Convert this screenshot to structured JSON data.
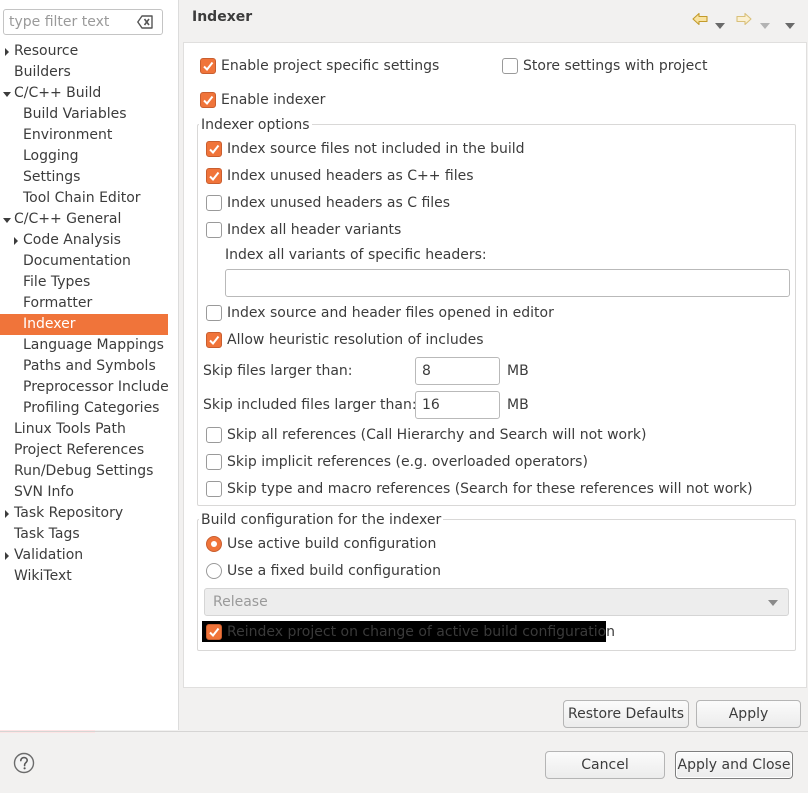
{
  "filter": {
    "placeholder": "type filter text"
  },
  "tree": [
    {
      "label": "Resource",
      "indent": 0,
      "arrow": "right"
    },
    {
      "label": "Builders",
      "indent": 0,
      "arrow": null
    },
    {
      "label": "C/C++ Build",
      "indent": 0,
      "arrow": "down"
    },
    {
      "label": "Build Variables",
      "indent": 1,
      "arrow": null
    },
    {
      "label": "Environment",
      "indent": 1,
      "arrow": null
    },
    {
      "label": "Logging",
      "indent": 1,
      "arrow": null
    },
    {
      "label": "Settings",
      "indent": 1,
      "arrow": null
    },
    {
      "label": "Tool Chain Editor",
      "indent": 1,
      "arrow": null
    },
    {
      "label": "C/C++ General",
      "indent": 0,
      "arrow": "down"
    },
    {
      "label": "Code Analysis",
      "indent": 1,
      "arrow": "right"
    },
    {
      "label": "Documentation",
      "indent": 1,
      "arrow": null
    },
    {
      "label": "File Types",
      "indent": 1,
      "arrow": null
    },
    {
      "label": "Formatter",
      "indent": 1,
      "arrow": null
    },
    {
      "label": "Indexer",
      "indent": 1,
      "arrow": null,
      "selected": true
    },
    {
      "label": "Language Mappings",
      "indent": 1,
      "arrow": null
    },
    {
      "label": "Paths and Symbols",
      "indent": 1,
      "arrow": null
    },
    {
      "label": "Preprocessor Include",
      "indent": 1,
      "arrow": null
    },
    {
      "label": "Profiling Categories",
      "indent": 1,
      "arrow": null
    },
    {
      "label": "Linux Tools Path",
      "indent": 0,
      "arrow": null
    },
    {
      "label": "Project References",
      "indent": 0,
      "arrow": null
    },
    {
      "label": "Run/Debug Settings",
      "indent": 0,
      "arrow": null
    },
    {
      "label": "SVN Info",
      "indent": 0,
      "arrow": null
    },
    {
      "label": "Task Repository",
      "indent": 0,
      "arrow": "right"
    },
    {
      "label": "Task Tags",
      "indent": 0,
      "arrow": null
    },
    {
      "label": "Validation",
      "indent": 0,
      "arrow": "right"
    },
    {
      "label": "WikiText",
      "indent": 0,
      "arrow": null
    }
  ],
  "header": {
    "title": "Indexer"
  },
  "project": {
    "enable_specific": {
      "label": "Enable project specific settings",
      "checked": true
    },
    "store_with_project": {
      "label": "Store settings with project",
      "checked": false
    },
    "enable_indexer": {
      "label": "Enable indexer",
      "checked": true
    }
  },
  "indexer_options": {
    "legend": "Indexer options",
    "index_not_in_build": {
      "label": "Index source files not included in the build",
      "checked": true
    },
    "unused_cpp": {
      "label": "Index unused headers as C++ files",
      "checked": true
    },
    "unused_c": {
      "label": "Index unused headers as C files",
      "checked": false
    },
    "all_variants": {
      "label": "Index all header variants",
      "checked": false
    },
    "specific_headers_label": "Index all variants of specific headers:",
    "specific_headers_value": "",
    "opened_in_editor": {
      "label": "Index source and header files opened in editor",
      "checked": false
    },
    "heuristic": {
      "label": "Allow heuristic resolution of includes",
      "checked": true
    },
    "skip_larger_label": "Skip files larger than:",
    "skip_larger_value": "8",
    "skip_larger_unit": "MB",
    "skip_included_label": "Skip included files larger than:",
    "skip_included_value": "16",
    "skip_included_unit": "MB",
    "skip_all_refs": {
      "label": "Skip all references (Call Hierarchy and Search will not work)",
      "checked": false
    },
    "skip_implicit": {
      "label": "Skip implicit references (e.g. overloaded operators)",
      "checked": false
    },
    "skip_type_macro": {
      "label": "Skip type and macro references (Search for these references will not work)",
      "checked": false
    }
  },
  "build_config": {
    "legend": "Build configuration for the indexer",
    "use_active": {
      "label": "Use active build configuration",
      "selected": true
    },
    "use_fixed": {
      "label": "Use a fixed build configuration",
      "selected": false
    },
    "fixed_value": "Release",
    "reindex": {
      "label": "Reindex project on change of active build configuration",
      "checked": true
    }
  },
  "buttons": {
    "restore_defaults": "Restore Defaults",
    "apply": "Apply",
    "cancel": "Cancel",
    "apply_close": "Apply and Close"
  },
  "colors": {
    "accent": "#f0743a",
    "selection": "#f0743a"
  }
}
